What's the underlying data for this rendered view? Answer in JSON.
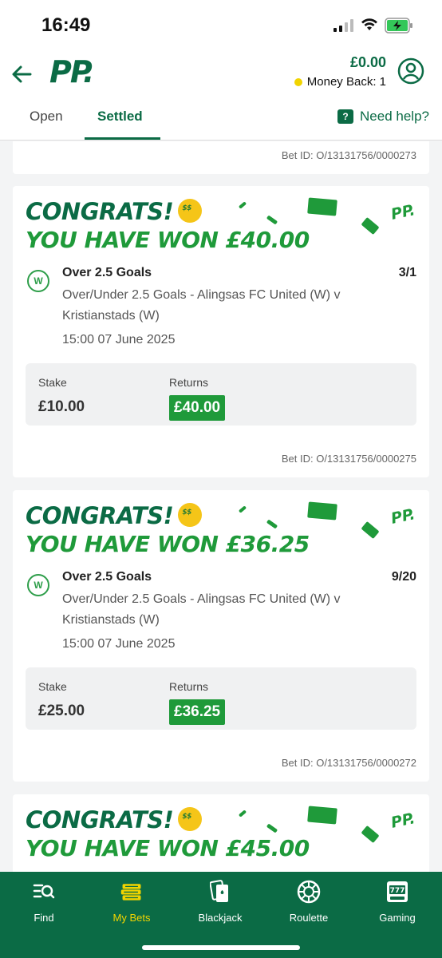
{
  "status_bar": {
    "time": "16:49"
  },
  "header": {
    "logo": "PP.",
    "balance": "£0.00",
    "money_back": "Money Back: 1"
  },
  "tabs": {
    "open": "Open",
    "settled": "Settled",
    "help": "Need help?"
  },
  "bets_top": {
    "bet_id": "Bet ID: O/13131756/0000273"
  },
  "bets": [
    {
      "congrats": "CONGRATS!",
      "won": "YOU HAVE WON £40.00",
      "selection": "Over 2.5 Goals",
      "odds": "3/1",
      "market": "Over/Under 2.5 Goals - Alingsas FC United (W) v Kristianstads (W)",
      "datetime": "15:00 07 June 2025",
      "stake_label": "Stake",
      "stake": "£10.00",
      "returns_label": "Returns",
      "returns": "£40.00",
      "bet_id": "Bet ID: O/13131756/0000275",
      "result_badge": "W"
    },
    {
      "congrats": "CONGRATS!",
      "won": "YOU HAVE WON £36.25",
      "selection": "Over 2.5 Goals",
      "odds": "9/20",
      "market": "Over/Under 2.5 Goals - Alingsas FC United (W) v Kristianstads (W)",
      "datetime": "15:00 07 June 2025",
      "stake_label": "Stake",
      "stake": "£25.00",
      "returns_label": "Returns",
      "returns": "£36.25",
      "bet_id": "Bet ID: O/13131756/0000272",
      "result_badge": "W"
    },
    {
      "congrats": "CONGRATS!",
      "won": "YOU HAVE WON £45.00"
    }
  ],
  "nav": {
    "items": [
      {
        "label": "Find",
        "icon": "search-list-icon"
      },
      {
        "label": "My Bets",
        "icon": "bets-icon"
      },
      {
        "label": "Blackjack",
        "icon": "cards-icon"
      },
      {
        "label": "Roulette",
        "icon": "roulette-icon"
      },
      {
        "label": "Gaming",
        "icon": "slot-machine-icon"
      }
    ],
    "active": "My Bets"
  },
  "colors": {
    "brand": "#0b6b45",
    "win": "#1f9a3a",
    "accent": "#f1d400"
  }
}
